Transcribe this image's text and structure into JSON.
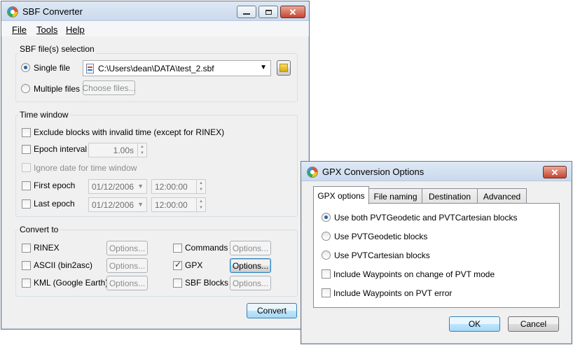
{
  "main_window": {
    "title": "SBF Converter",
    "menu": [
      "File",
      "Tools",
      "Help"
    ],
    "sbf_selection": {
      "group_label": "SBF file(s) selection",
      "single_file_label": "Single file",
      "single_file_selected": true,
      "file_path": "C:\\Users\\dean\\DATA\\test_2.sbf",
      "multiple_files_label": "Multiple files",
      "choose_files_label": "Choose files..."
    },
    "time_window": {
      "group_label": "Time window",
      "exclude_invalid_label": "Exclude blocks with invalid time (except for RINEX)",
      "epoch_interval_label": "Epoch interval",
      "epoch_interval_value": "1.00s",
      "ignore_date_label": "Ignore date for time window",
      "first_epoch_label": "First epoch",
      "first_epoch_date": "01/12/2006",
      "first_epoch_time": "12:00:00",
      "last_epoch_label": "Last epoch",
      "last_epoch_date": "01/12/2006",
      "last_epoch_time": "12:00:00"
    },
    "convert_to": {
      "group_label": "Convert to",
      "options_label": "Options...",
      "rinex_label": "RINEX",
      "ascii_label": "ASCII (bin2asc)",
      "kml_label": "KML (Google Earth)",
      "commands_label": "Commands",
      "gpx_label": "GPX",
      "gpx_checked": true,
      "sbf_blocks_label": "SBF Blocks"
    },
    "convert_button": "Convert"
  },
  "gpx_dialog": {
    "title": "GPX Conversion Options",
    "tabs": [
      "GPX options",
      "File naming",
      "Destination",
      "Advanced"
    ],
    "selected_tab": "GPX options",
    "radio_both": "Use both PVTGeodetic and PVTCartesian blocks",
    "radio_geodetic": "Use PVTGeodetic blocks",
    "radio_cartesian": "Use PVTCartesian blocks",
    "selected_radio": "both",
    "waypoints_mode_label": "Include Waypoints on change of PVT mode",
    "waypoints_error_label": "Include Waypoints on PVT error",
    "ok_label": "OK",
    "cancel_label": "Cancel"
  },
  "colors": {
    "window_bg": "#f0f0f0",
    "titlebar": "#c9d9ec",
    "close_button": "#c7452f",
    "focus_blue": "#3c7fb1"
  },
  "icons": {
    "app": "sbf-converter-icon",
    "browse": "folder-icon",
    "file_type": "sbf-file-icon"
  }
}
